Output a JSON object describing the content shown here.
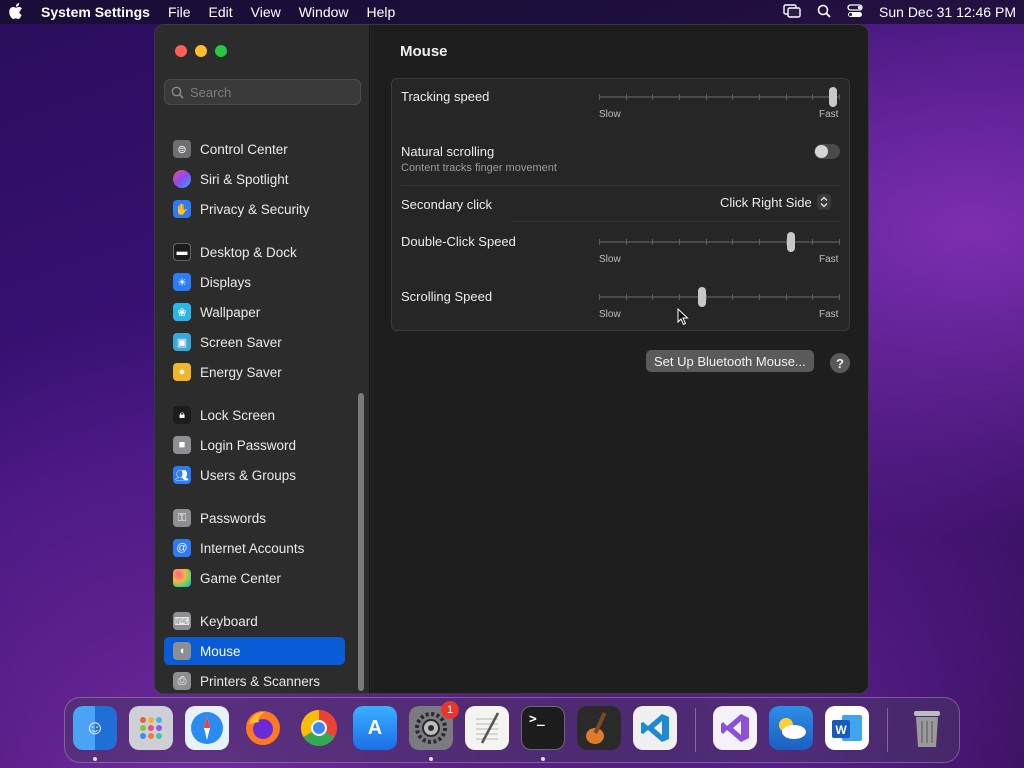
{
  "menubar": {
    "app_name": "System Settings",
    "menus": [
      "File",
      "Edit",
      "View",
      "Window",
      "Help"
    ],
    "clock": "Sun Dec 31  12:46 PM"
  },
  "sidebar": {
    "search_placeholder": "Search",
    "items": [
      {
        "label": "Control Center",
        "icon": "control-center-icon",
        "color": "#6e6e73"
      },
      {
        "label": "Siri & Spotlight",
        "icon": "siri-icon",
        "color": "#c63fd6"
      },
      {
        "label": "Privacy & Security",
        "icon": "hand-icon",
        "color": "#2d7cf6"
      },
      {
        "label": "Desktop & Dock",
        "icon": "dock-icon",
        "color": "#1c1c1e"
      },
      {
        "label": "Displays",
        "icon": "sun-icon",
        "color": "#2d7cf6"
      },
      {
        "label": "Wallpaper",
        "icon": "flower-icon",
        "color": "#2bb5e8"
      },
      {
        "label": "Screen Saver",
        "icon": "screensaver-icon",
        "color": "#3aa8d8"
      },
      {
        "label": "Energy Saver",
        "icon": "bulb-icon",
        "color": "#f2b52a"
      },
      {
        "label": "Lock Screen",
        "icon": "lock-icon",
        "color": "#1c1c1e"
      },
      {
        "label": "Login Password",
        "icon": "lock-icon",
        "color": "#8e8e93"
      },
      {
        "label": "Users & Groups",
        "icon": "users-icon",
        "color": "#2d7cf6"
      },
      {
        "label": "Passwords",
        "icon": "key-icon",
        "color": "#8e8e93"
      },
      {
        "label": "Internet Accounts",
        "icon": "at-icon",
        "color": "#2d7cf6"
      },
      {
        "label": "Game Center",
        "icon": "game-center-icon",
        "color": "#e0e0e0"
      },
      {
        "label": "Keyboard",
        "icon": "keyboard-icon",
        "color": "#8e8e93"
      },
      {
        "label": "Mouse",
        "icon": "mouse-icon",
        "color": "#8e8e93",
        "selected": true
      },
      {
        "label": "Printers & Scanners",
        "icon": "printer-icon",
        "color": "#8e8e93"
      }
    ]
  },
  "content": {
    "title": "Mouse",
    "tracking": {
      "label": "Tracking speed",
      "slow": "Slow",
      "fast": "Fast",
      "value": 1.0
    },
    "natural": {
      "label": "Natural scrolling",
      "sub": "Content tracks finger movement",
      "on": false
    },
    "secondary": {
      "label": "Secondary click",
      "value": "Click Right Side"
    },
    "doubleclick": {
      "label": "Double-Click Speed",
      "slow": "Slow",
      "fast": "Fast",
      "value": 0.8
    },
    "scrolling": {
      "label": "Scrolling Speed",
      "slow": "Slow",
      "fast": "Fast",
      "value": 0.43
    },
    "bt_button": "Set Up Bluetooth Mouse...",
    "help": "?"
  },
  "dock": {
    "settings_badge": "1",
    "apps": [
      "Finder",
      "Launchpad",
      "Safari",
      "Firefox",
      "Chrome",
      "App Store",
      "System Settings",
      "TextEdit",
      "Terminal",
      "GarageBand",
      "VS Code",
      "Visual Studio",
      "Weather",
      "Word",
      "Trash"
    ]
  }
}
